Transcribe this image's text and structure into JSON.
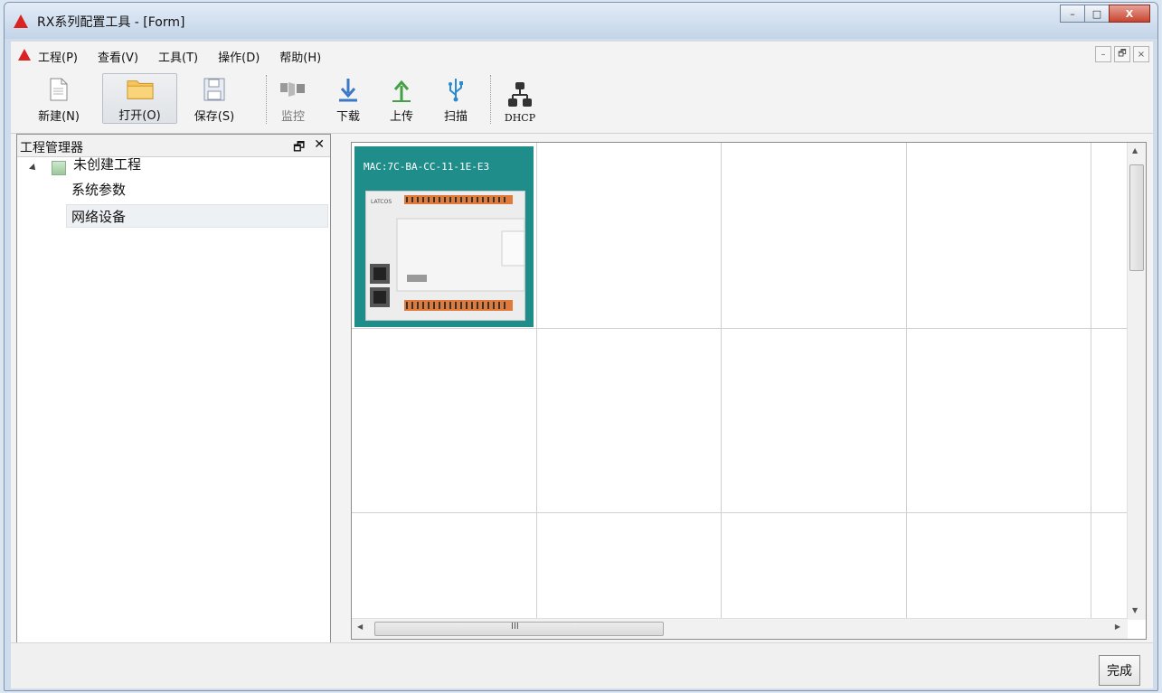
{
  "window": {
    "title": "RX系列配置工具 - [Form]",
    "controls": {
      "minimize": "–",
      "maximize": "□",
      "close": "X"
    }
  },
  "menubar": {
    "items": [
      {
        "label": "工程(P)"
      },
      {
        "label": "查看(V)"
      },
      {
        "label": "工具(T)"
      },
      {
        "label": "操作(D)"
      },
      {
        "label": "帮助(H)"
      }
    ],
    "mdi": {
      "minimize": "–",
      "restore": "🗗",
      "close": "×"
    }
  },
  "toolbar": {
    "new_label": "新建(N)",
    "open_label": "打开(O)",
    "save_label": "保存(S)",
    "monitor_label": "监控",
    "download_label": "下载",
    "upload_label": "上传",
    "scan_label": "扫描",
    "dhcp_label": "DHCP"
  },
  "project_panel": {
    "title": "工程管理器",
    "pin": "🗗",
    "close": "✕",
    "tree": {
      "root": "未创建工程",
      "children": [
        "系统参数",
        "网络设备"
      ]
    }
  },
  "device_grid": {
    "devices": [
      {
        "mac": "MAC:7C-BA-CC-11-1E-E3",
        "brand": "LATCOS"
      }
    ],
    "hscroll_label": "III"
  },
  "statusbar": {
    "done_label": "完成"
  },
  "colors": {
    "accent": "#1f8e8b",
    "logo": "#d92424"
  }
}
